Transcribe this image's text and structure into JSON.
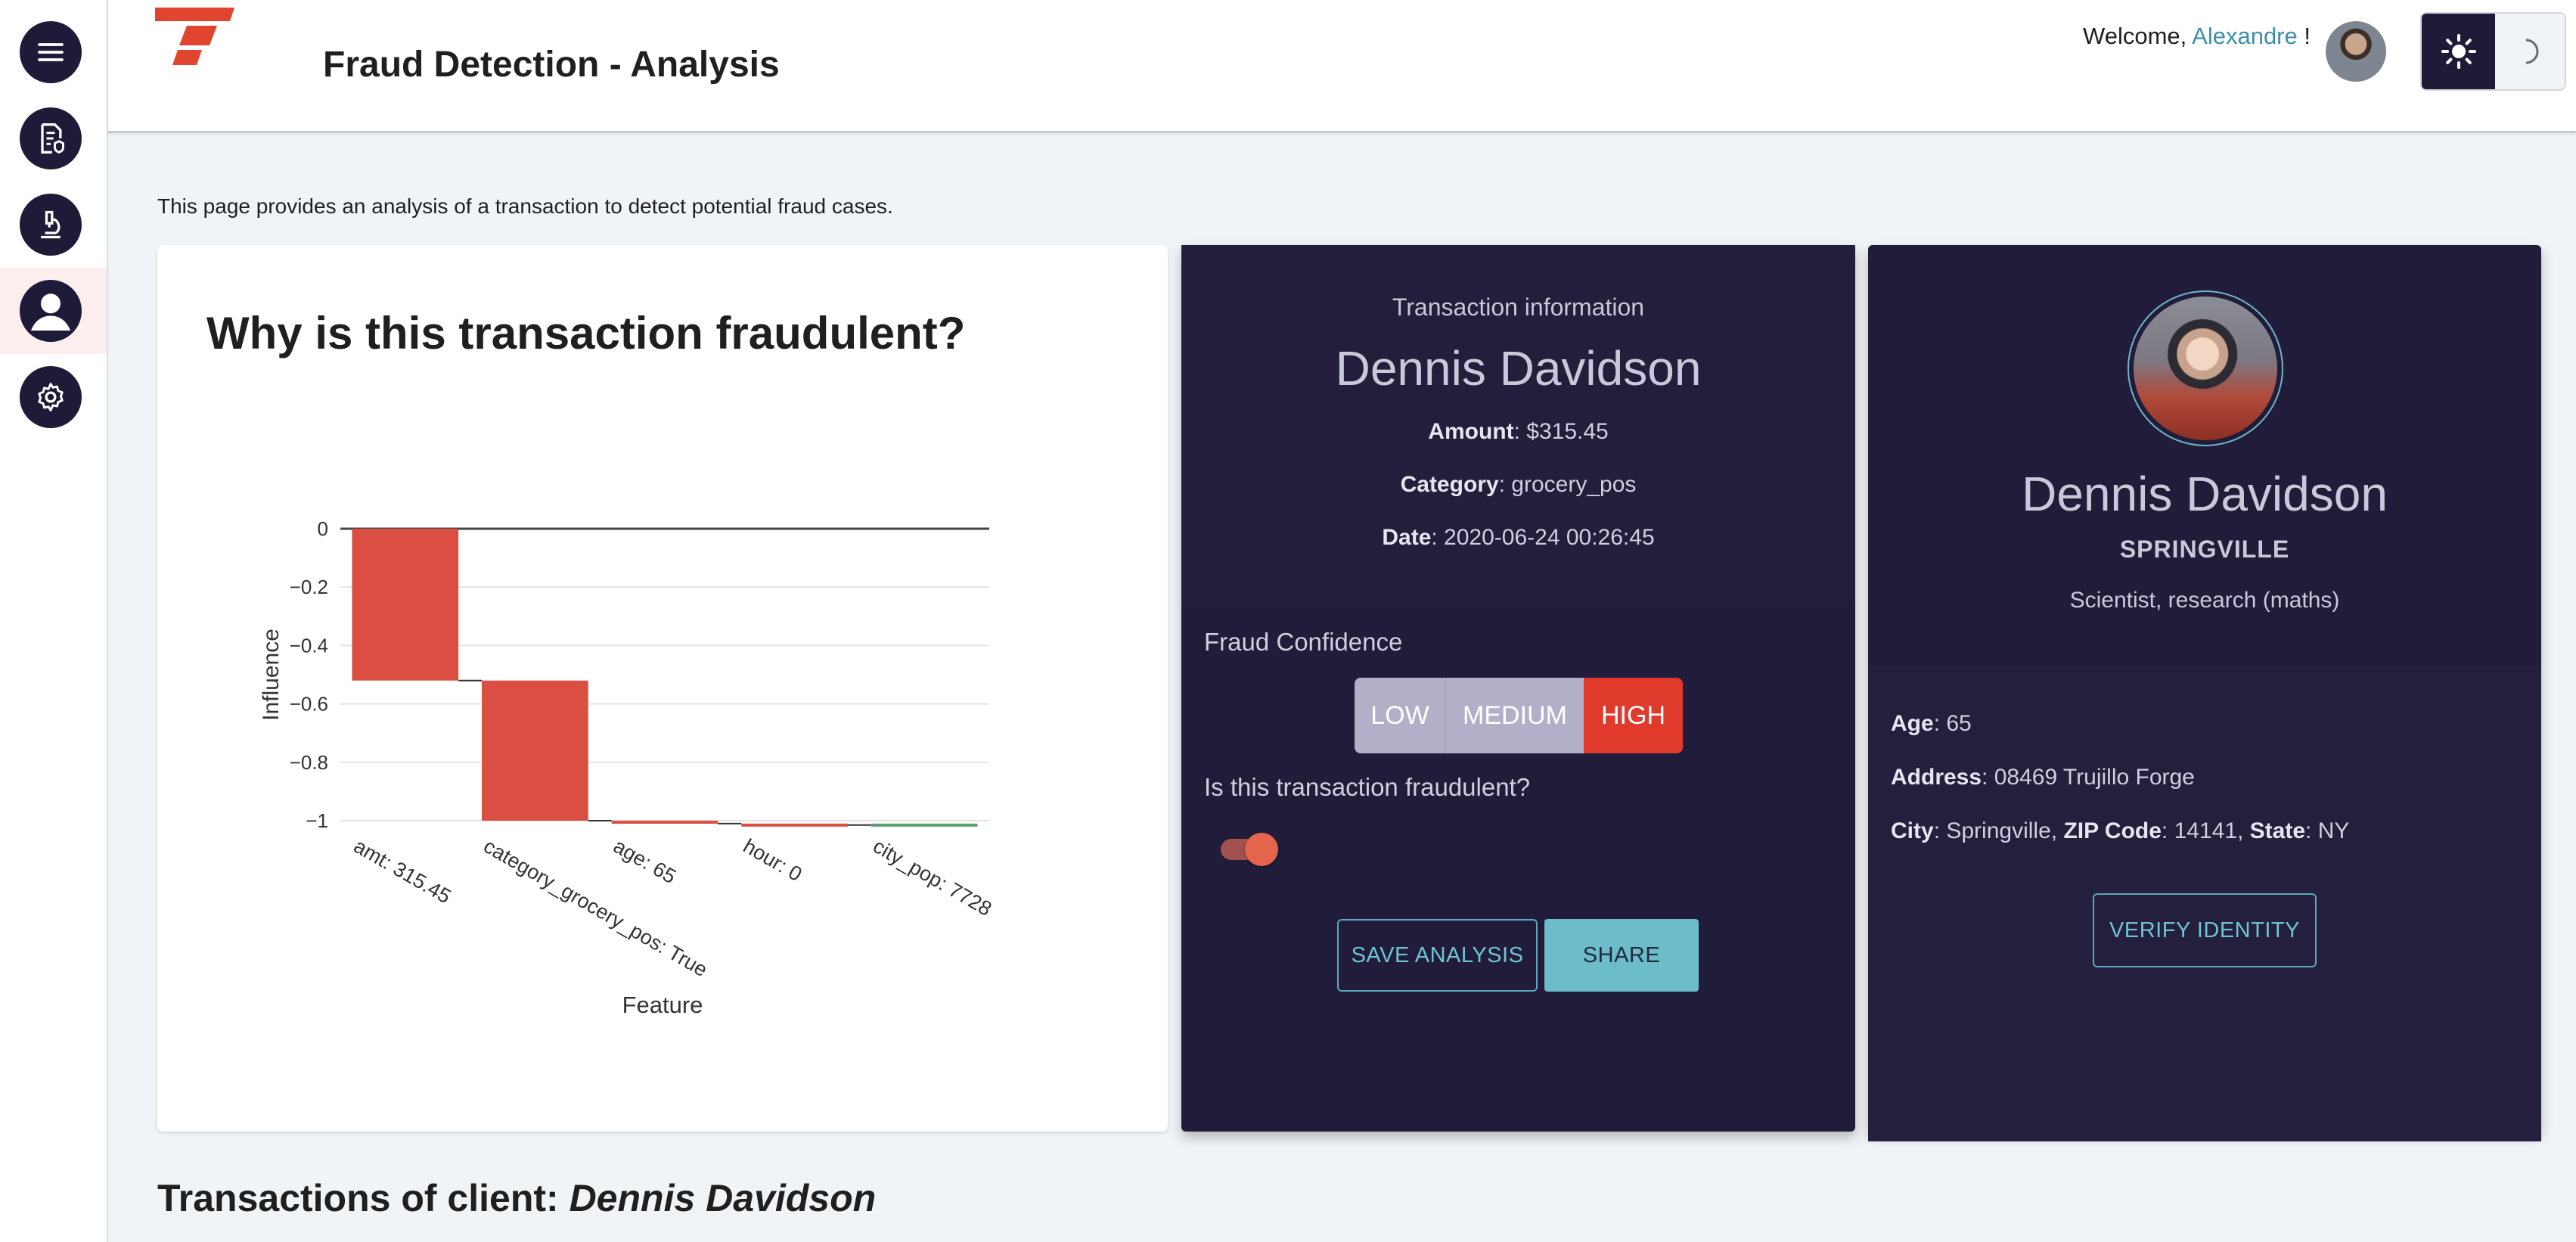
{
  "header": {
    "title": "Fraud Detection - Analysis",
    "welcome_prefix": "Welcome, ",
    "user_name": "Alexandre",
    "welcome_suffix": " !"
  },
  "sidebar": {
    "items": [
      {
        "icon": "menu-icon"
      },
      {
        "icon": "report-icon"
      },
      {
        "icon": "microscope-icon"
      },
      {
        "icon": "person-icon",
        "active": true
      },
      {
        "icon": "gear-icon"
      }
    ]
  },
  "page": {
    "description": "This page provides an analysis of a transaction to detect potential fraud cases."
  },
  "chart_card": {
    "title": "Why is this transaction fraudulent?"
  },
  "chart_data": {
    "type": "bar",
    "subtype": "waterfall",
    "xlabel": "Feature",
    "ylabel": "Influence",
    "ylim": [
      -1,
      0
    ],
    "yticks": [
      "0",
      "−0.2",
      "−0.4",
      "−0.6",
      "−0.8",
      "−1"
    ],
    "categories": [
      "amt: 315.45",
      "category_grocery_pos: True",
      "age: 65",
      "hour: 0",
      "city_pop: 7728"
    ],
    "values": [
      -0.52,
      -0.48,
      -0.01,
      -0.005,
      0.005
    ],
    "colors": {
      "negative": "#db4f42",
      "positive": "#5a9e6f",
      "connector": "#333333"
    }
  },
  "transaction": {
    "heading": "Transaction information",
    "name": "Dennis Davidson",
    "amount_label": "Amount",
    "amount_value": ": $315.45",
    "category_label": "Category",
    "category_value": ": grocery_pos",
    "date_label": "Date",
    "date_value": ": 2020-06-24 00:26:45",
    "confidence_label": "Fraud Confidence",
    "confidence_levels": [
      "LOW",
      "MEDIUM",
      "HIGH"
    ],
    "confidence_selected": "HIGH",
    "fraud_question": "Is this transaction fraudulent?",
    "fraud_toggle_on": true,
    "save_label": "SAVE ANALYSIS",
    "share_label": "SHARE"
  },
  "client": {
    "name": "Dennis Davidson",
    "city_upper": "SPRINGVILLE",
    "job": "Scientist, research (maths)",
    "age_label": "Age",
    "age_value": ": 65",
    "address_label": "Address",
    "address_value": ": 08469 Trujillo Forge",
    "city_label": "City",
    "city_value": ": Springville, ",
    "zip_label": "ZIP Code",
    "zip_value": ": 14141, ",
    "state_label": "State",
    "state_value": ": NY",
    "verify_label": "VERIFY IDENTITY"
  },
  "transactions_section": {
    "prefix": "Transactions of client: ",
    "name": "Dennis Davidson"
  },
  "colors": {
    "dark_card": "#201c39",
    "accent_red": "#e03a2c",
    "teal": "#6cbcc9"
  }
}
